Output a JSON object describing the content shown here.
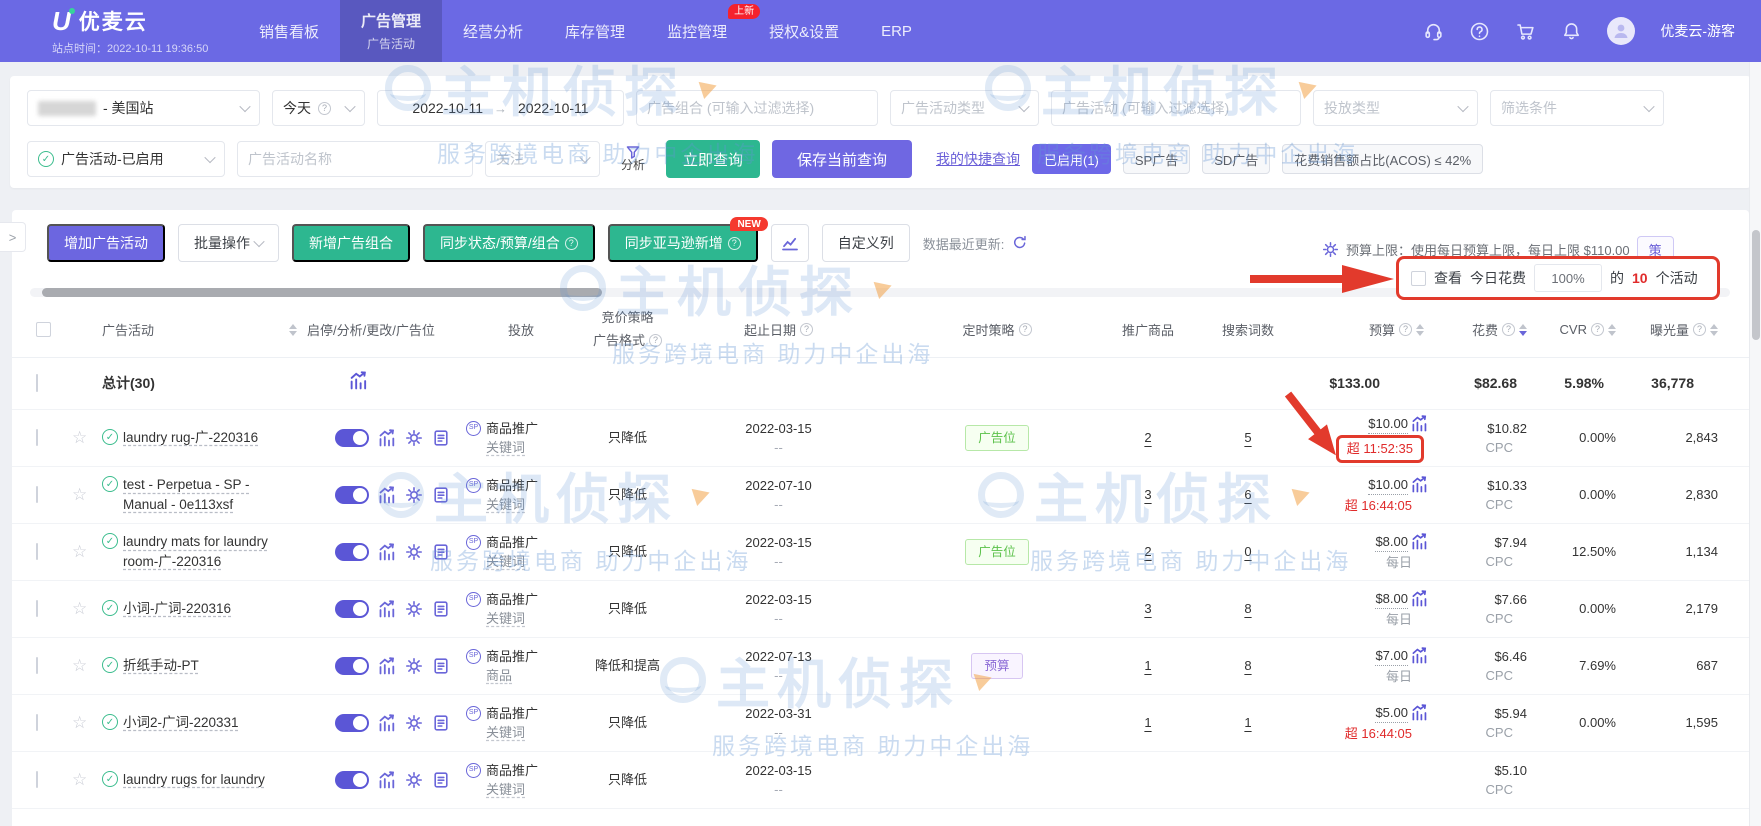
{
  "navbar": {
    "logo_u": "U",
    "logo_text": "优麦云",
    "site_time": "站点时间：2022-10-11 19:36:50",
    "menu": [
      {
        "label": "销售看板"
      },
      {
        "label": "广告管理",
        "sub": "广告活动"
      },
      {
        "label": "经营分析"
      },
      {
        "label": "库存管理"
      },
      {
        "label": "监控管理",
        "badge": "上新"
      },
      {
        "label": "授权&设置"
      },
      {
        "label": "ERP"
      }
    ],
    "username": "优麦云-游客"
  },
  "filters": {
    "site_value": "- 美国站",
    "date_preset": "今天",
    "date_start": "2022-10-11",
    "date_end": "2022-10-11",
    "date_sep": "→",
    "portfolio_placeholder": "广告组合 (可输入过滤选择)",
    "campaign_type_placeholder": "广告活动类型",
    "campaign_placeholder": "广告活动 (可输入过滤选择)",
    "targeting_type_placeholder": "投放类型",
    "condition_placeholder": "筛选条件",
    "status_value": "广告活动-已启用",
    "name_placeholder": "广告活动名称",
    "follow_label": "关注",
    "analyze_label": "分析",
    "query_button": "立即查询",
    "save_button": "保存当前查询",
    "quick_link": "我的快捷查询",
    "chips": [
      {
        "label": "已启用(1)"
      },
      {
        "label": "SP广告"
      },
      {
        "label": "SD广告"
      },
      {
        "label": "花费销售额占比(ACOS) ≤ 42%"
      }
    ]
  },
  "toolbar": {
    "expander": ">",
    "add_campaign": "增加广告活动",
    "batch_ops": "批量操作",
    "new_portfolio": "新增广告组合",
    "sync_status": "同步状态/预算/组合",
    "sync_amazon": "同步亚马逊新增",
    "new_badge": "NEW",
    "custom_columns": "自定义列",
    "last_update_label": "数据最近更新:",
    "budget_cap_text": "预算上限：使用每日预算上限，每日上限 $110.00",
    "cap_button": "策",
    "note": {
      "view": "查看",
      "spend_label": "今日花费",
      "percent": "100%",
      "of": "的",
      "count": "10",
      "suffix": "个活动"
    }
  },
  "watermark": {
    "title": "主机侦探",
    "tagline": "服务跨境电商 助力中企出海"
  },
  "table": {
    "headers": {
      "campaign": "广告活动",
      "controls": "启停/分析/更改/广告位",
      "targeting": "投放",
      "bid_line1": "竞价策略",
      "bid_line2": "广告格式",
      "dates": "起止日期",
      "timer": "定时策略",
      "products": "推广商品",
      "search_terms": "搜索词数",
      "budget": "预算",
      "spend": "花费",
      "cvr": "CVR",
      "impressions": "曝光量"
    },
    "summary": {
      "label": "总计(30)",
      "budget": "$133.00",
      "spend": "$82.68",
      "cvr": "5.98%",
      "impressions": "36,778"
    },
    "rows": [
      {
        "name": "laundry rug-广-220316",
        "type": "商品推广",
        "type_sub": "关键词",
        "strategy": "只降低",
        "date": "2022-03-15",
        "date_sub": "--",
        "timer": "广告位",
        "products": "2",
        "terms": "5",
        "budget": "$10.00",
        "budget_sub": "超 11:52:35",
        "spend": "$10.82",
        "spend_sub": "CPC",
        "cvr": "0.00%",
        "impressions": "2,843"
      },
      {
        "name": "test - Perpetua - SP - Manual - 0e113xsf",
        "type": "商品推广",
        "type_sub": "关键词",
        "strategy": "只降低",
        "date": "2022-07-10",
        "date_sub": "--",
        "timer": "",
        "products": "3",
        "terms": "6",
        "budget": "$10.00",
        "budget_sub": "超 16:44:05",
        "spend": "$10.33",
        "spend_sub": "CPC",
        "cvr": "0.00%",
        "impressions": "2,830"
      },
      {
        "name": "laundry mats for laundry room-广-220316",
        "type": "商品推广",
        "type_sub": "关键词",
        "strategy": "只降低",
        "date": "2022-03-15",
        "date_sub": "--",
        "timer": "广告位",
        "products": "2",
        "terms": "0",
        "budget": "$8.00",
        "budget_sub": "每日",
        "spend": "$7.94",
        "spend_sub": "CPC",
        "cvr": "12.50%",
        "impressions": "1,134"
      },
      {
        "name": "小词-广词-220316",
        "type": "商品推广",
        "type_sub": "关键词",
        "strategy": "只降低",
        "date": "2022-03-15",
        "date_sub": "--",
        "timer": "",
        "products": "3",
        "terms": "8",
        "budget": "$8.00",
        "budget_sub": "每日",
        "spend": "$7.66",
        "spend_sub": "CPC",
        "cvr": "0.00%",
        "impressions": "2,179"
      },
      {
        "name": "折纸手动-PT",
        "type": "商品推广",
        "type_sub": "商品",
        "strategy": "降低和提高",
        "date": "2022-07-13",
        "date_sub": "--",
        "timer": "预算",
        "products": "1",
        "terms": "8",
        "budget": "$7.00",
        "budget_sub": "每日",
        "spend": "$6.46",
        "spend_sub": "CPC",
        "cvr": "7.69%",
        "impressions": "687"
      },
      {
        "name": "小词2-广词-220331",
        "type": "商品推广",
        "type_sub": "关键词",
        "strategy": "只降低",
        "date": "2022-03-31",
        "date_sub": "--",
        "timer": "",
        "products": "1",
        "terms": "1",
        "budget": "$5.00",
        "budget_sub": "超 16:44:05",
        "spend": "$5.94",
        "spend_sub": "CPC",
        "cvr": "0.00%",
        "impressions": "1,595"
      },
      {
        "name": "laundry rugs for laundry",
        "type": "商品推广",
        "type_sub": "关键词",
        "strategy": "只降低",
        "date": "2022-03-15",
        "date_sub": "--",
        "timer": "",
        "products": "",
        "terms": "",
        "budget": "",
        "budget_sub": "",
        "spend": "$5.10",
        "spend_sub": "CPC",
        "cvr": "",
        "impressions": ""
      }
    ]
  }
}
